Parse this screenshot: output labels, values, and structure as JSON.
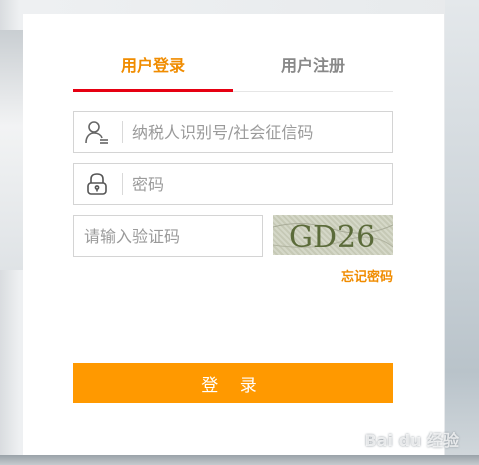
{
  "tabs": [
    {
      "label": "用户登录",
      "active": true
    },
    {
      "label": "用户注册",
      "active": false
    }
  ],
  "fields": {
    "username_placeholder": "纳税人识别号/社会征信码",
    "password_placeholder": "密码",
    "captcha_placeholder": "请输入验证码"
  },
  "captcha_text": "GD26",
  "forgot_password": "忘记密码",
  "login_button": "登 录",
  "watermark": "Bai du 经验",
  "icons": {
    "user": "user-icon",
    "lock": "lock-icon"
  },
  "colors": {
    "accent": "#f08c00",
    "tab_underline": "#e60012",
    "button": "#ff9900"
  }
}
